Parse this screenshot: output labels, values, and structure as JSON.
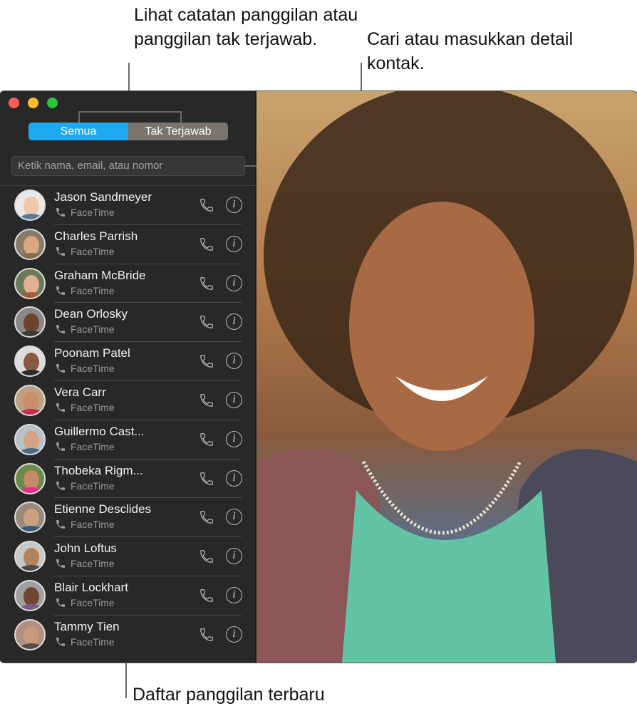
{
  "callouts": {
    "segments": "Lihat catatan panggilan atau panggilan tak terjawab.",
    "search": "Cari atau masukkan detail kontak.",
    "recent": "Daftar panggilan terbaru"
  },
  "window": {
    "traffic_lights": [
      "close",
      "minimize",
      "maximize"
    ],
    "colors": {
      "close": "#fe5f57",
      "minimize": "#febc2e",
      "maximize": "#28c840",
      "accent": "#1eaaf1"
    }
  },
  "segmented": {
    "active": "Semua",
    "inactive": "Tak Terjawab"
  },
  "search": {
    "placeholder": "Ketik nama, email, atau nomor"
  },
  "calls": [
    {
      "name": "Jason Sandmeyer",
      "type": "FaceTime"
    },
    {
      "name": "Charles Parrish",
      "type": "FaceTime"
    },
    {
      "name": "Graham McBride",
      "type": "FaceTime"
    },
    {
      "name": "Dean Orlosky",
      "type": "FaceTime"
    },
    {
      "name": "Poonam Patel",
      "type": "FaceTime"
    },
    {
      "name": "Vera Carr",
      "type": "FaceTime"
    },
    {
      "name": "Guillermo Cast...",
      "type": "FaceTime"
    },
    {
      "name": "Thobeka Rigm...",
      "type": "FaceTime"
    },
    {
      "name": "Etienne Desclides",
      "type": "FaceTime"
    },
    {
      "name": "John Loftus",
      "type": "FaceTime"
    },
    {
      "name": "Blair Lockhart",
      "type": "FaceTime"
    },
    {
      "name": "Tammy Tien",
      "type": "FaceTime"
    }
  ],
  "icons": {
    "call": "phone-icon",
    "info": "info-icon",
    "call_type": "phone-small-icon"
  }
}
